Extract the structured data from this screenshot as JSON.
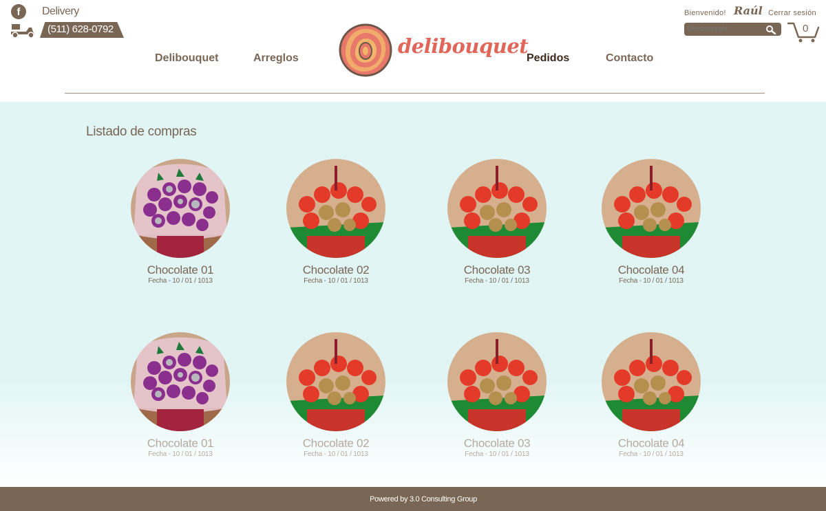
{
  "header": {
    "facebook_icon": "facebook-icon",
    "delivery_label": "Delivery",
    "phone": "(511)  628-0792",
    "scooter_icon": "scooter-icon",
    "nav": [
      {
        "label": "Delibouquet",
        "active": false
      },
      {
        "label": "Arreglos",
        "active": false
      },
      {
        "label": "Pedidos",
        "active": true
      },
      {
        "label": "Contacto",
        "active": false
      }
    ],
    "logo_text": "delibouquet",
    "welcome": "Bienvenido!",
    "user_name": "Raúl",
    "logout": "Cerrar sesión",
    "search_placeholder": "Delibouquet",
    "cart_count": "0"
  },
  "main": {
    "title": "Listado de compras",
    "purchases": [
      {
        "name": "Chocolate 01",
        "date": "Fecha - 10 / 01 / 1013",
        "variant": "purple"
      },
      {
        "name": "Chocolate 02",
        "date": "Fecha - 10 / 01 / 1013",
        "variant": "red"
      },
      {
        "name": "Chocolate 03",
        "date": "Fecha - 10 / 01 / 1013",
        "variant": "red"
      },
      {
        "name": "Chocolate 04",
        "date": "Fecha - 10 / 01 / 1013",
        "variant": "red"
      },
      {
        "name": "Chocolate 01",
        "date": "Fecha - 10 / 01 / 1013",
        "variant": "purple"
      },
      {
        "name": "Chocolate 02",
        "date": "Fecha - 10 / 01 / 1013",
        "variant": "red"
      },
      {
        "name": "Chocolate 03",
        "date": "Fecha - 10 / 01 / 1013",
        "variant": "red"
      },
      {
        "name": "Chocolate 04",
        "date": "Fecha - 10 / 01 / 1013",
        "variant": "red"
      }
    ]
  },
  "footer": {
    "text": "Powered by 3.0 Consulting Group"
  },
  "colors": {
    "brand_brown": "#7a6655",
    "logo_coral": "#e0665a",
    "background_mint": "#e1f5f5"
  }
}
